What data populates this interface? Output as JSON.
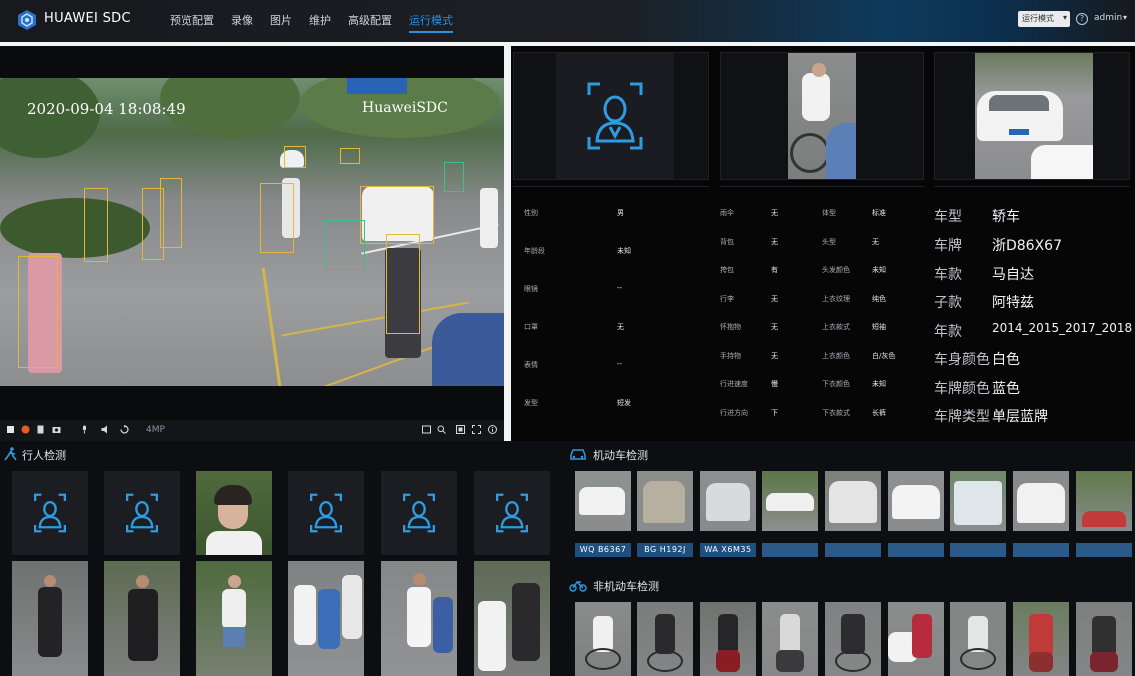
{
  "header": {
    "brand": "HUAWEI SDC",
    "nav": [
      "预览配置",
      "录像",
      "图片",
      "维护",
      "高级配置",
      "运行模式"
    ],
    "active_nav": 5,
    "mode_select": "运行模式",
    "user": "admin",
    "accent": "#2f8fe0"
  },
  "video": {
    "timestamp": "2020-09-04 18:08:49",
    "camera_name": "HuaweiSDC",
    "resolution": "4MP"
  },
  "attributes": {
    "col1": [
      {
        "k": "性别",
        "v": "男"
      },
      {
        "k": "年龄段",
        "v": "未知"
      },
      {
        "k": "眼镜",
        "v": "--"
      },
      {
        "k": "口罩",
        "v": "无"
      },
      {
        "k": "表情",
        "v": "--"
      },
      {
        "k": "发型",
        "v": "短发"
      }
    ],
    "col2": [
      {
        "k": "雨伞",
        "v": "无"
      },
      {
        "k": "背包",
        "v": "无"
      },
      {
        "k": "挎包",
        "v": "有"
      },
      {
        "k": "行李",
        "v": "无"
      },
      {
        "k": "怀抱物",
        "v": "无"
      },
      {
        "k": "手持物",
        "v": "无"
      },
      {
        "k": "行进速度",
        "v": "慢"
      },
      {
        "k": "行进方向",
        "v": "下"
      }
    ],
    "col3": [
      {
        "k": "体型",
        "v": "标准"
      },
      {
        "k": "头型",
        "v": "无"
      },
      {
        "k": "头发颜色",
        "v": "未知"
      },
      {
        "k": "上衣纹理",
        "v": "纯色"
      },
      {
        "k": "上衣款式",
        "v": "短袖"
      },
      {
        "k": "上衣颜色",
        "v": "白/灰色"
      },
      {
        "k": "下衣颜色",
        "v": "未知"
      },
      {
        "k": "下衣款式",
        "v": "长裤"
      }
    ],
    "vehicle": [
      {
        "k": "车型",
        "v": "轿车"
      },
      {
        "k": "车牌",
        "v": "浙D86X67"
      },
      {
        "k": "车款",
        "v": "马自达"
      },
      {
        "k": "子款",
        "v": "阿特兹"
      },
      {
        "k": "年款",
        "v": "2014_2015_2017_2018"
      },
      {
        "k": "车身颜色",
        "v": "白色"
      },
      {
        "k": "车牌颜色",
        "v": "蓝色"
      },
      {
        "k": "车牌类型",
        "v": "单层蓝牌"
      }
    ]
  },
  "sections": {
    "pedestrian": "行人检测",
    "vehicle": "机动车检测",
    "nonmotor": "非机动车检测"
  },
  "plates": [
    "WQ B6367",
    "BG H192J",
    "WA X6M35",
    "",
    "",
    "",
    "",
    "",
    ""
  ]
}
